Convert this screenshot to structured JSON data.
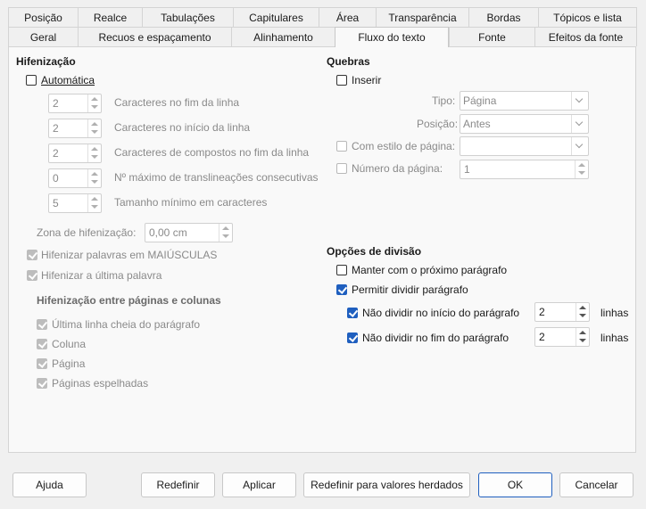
{
  "tabs_top": [
    "Posição",
    "Realce",
    "Tabulações",
    "Capitulares",
    "Área",
    "Transparência",
    "Bordas",
    "Tópicos e lista"
  ],
  "tabs_bottom": [
    "Geral",
    "Recuos e espaçamento",
    "Alinhamento",
    "Fluxo do texto",
    "Fonte",
    "Efeitos da fonte"
  ],
  "active_tab": "Fluxo do texto",
  "hyphenation": {
    "title": "Hifenização",
    "automatic_label": "Automática",
    "automatic_checked": false,
    "spins": [
      {
        "value": "2",
        "label": "Caracteres no fim da linha"
      },
      {
        "value": "2",
        "label": "Caracteres no início da linha"
      },
      {
        "value": "2",
        "label": "Caracteres de compostos no fim da linha"
      },
      {
        "value": "0",
        "label": "Nº máximo de translineações consecutivas"
      },
      {
        "value": "5",
        "label": "Tamanho mínimo em caracteres"
      }
    ],
    "zone_label": "Zona de hifenização:",
    "zone_value": "0,00 cm",
    "caps_label": "Hifenizar palavras em MAIÚSCULAS",
    "last_word_label": "Hifenizar a última palavra",
    "across_title": "Hifenização entre páginas e colunas",
    "across_items": [
      "Última linha cheia do parágrafo",
      "Coluna",
      "Página",
      "Páginas espelhadas"
    ]
  },
  "breaks": {
    "title": "Quebras",
    "insert_label": "Inserir",
    "type_label": "Tipo:",
    "type_value": "Página",
    "position_label": "Posição:",
    "position_value": "Antes",
    "page_style_label": "Com estilo de página:",
    "page_style_value": "",
    "page_number_label": "Número da página:",
    "page_number_value": "1"
  },
  "split": {
    "title": "Opções de divisão",
    "keep_next_label": "Manter com o próximo parágrafo",
    "keep_next_checked": false,
    "allow_split_label": "Permitir dividir parágrafo",
    "allow_split_checked": true,
    "orphan_label": "Não dividir no início do parágrafo",
    "orphan_checked": true,
    "orphan_value": "2",
    "widow_label": "Não dividir no fim do parágrafo",
    "widow_checked": true,
    "widow_value": "2",
    "lines_label": "linhas"
  },
  "buttons": {
    "help": "Ajuda",
    "reset": "Redefinir",
    "apply": "Aplicar",
    "inherited": "Redefinir para valores herdados",
    "ok": "OK",
    "cancel": "Cancelar"
  },
  "colors": {
    "accent": "#1f5fbf"
  }
}
